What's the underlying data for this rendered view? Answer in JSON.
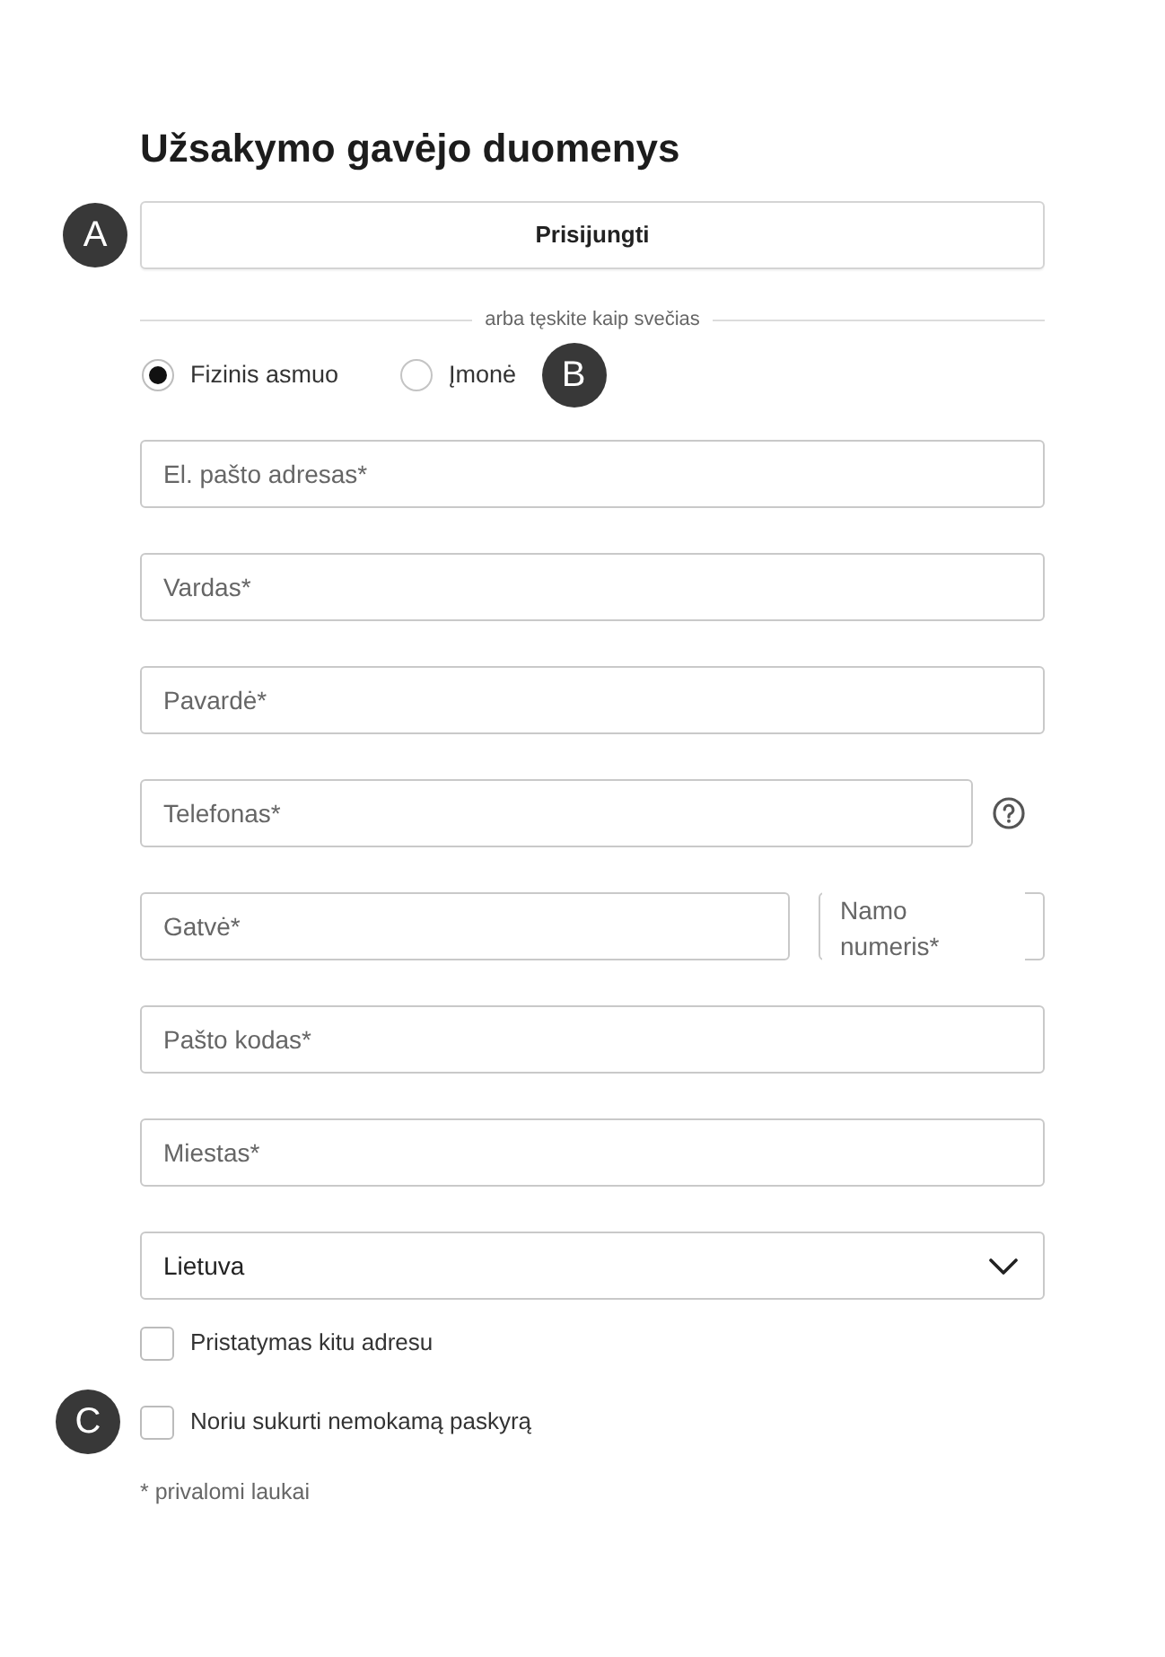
{
  "title": "Užsakymo gavėjo duomenys",
  "login_button": {
    "label": "Prisijungti",
    "badge": "A"
  },
  "divider_text": "arba tęskite kaip svečias",
  "customer_type": {
    "options": [
      {
        "label": "Fizinis asmuo",
        "selected": true
      },
      {
        "label": "Įmonė",
        "selected": false
      }
    ],
    "badge": "B"
  },
  "fields": [
    {
      "kind": "text",
      "placeholder": "El. pašto adresas*"
    },
    {
      "kind": "text",
      "placeholder": "Vardas*"
    },
    {
      "kind": "text",
      "placeholder": "Pavardė*"
    },
    {
      "kind": "help",
      "placeholder": "Telefonas*"
    },
    {
      "kind": "pair",
      "placeholder": "Gatvė*",
      "side_label": "Namo numeris*"
    },
    {
      "kind": "text",
      "placeholder": "Pašto kodas*"
    },
    {
      "kind": "text",
      "placeholder": "Miestas*"
    },
    {
      "kind": "select",
      "value": "Lietuva"
    }
  ],
  "checkboxes": [
    {
      "label": "Pristatymas kitu adresu",
      "checked": false
    },
    {
      "label": "Noriu sukurti nemokamą paskyrą",
      "checked": false,
      "badge": "C"
    }
  ],
  "footnote": "* privalomi laukai"
}
